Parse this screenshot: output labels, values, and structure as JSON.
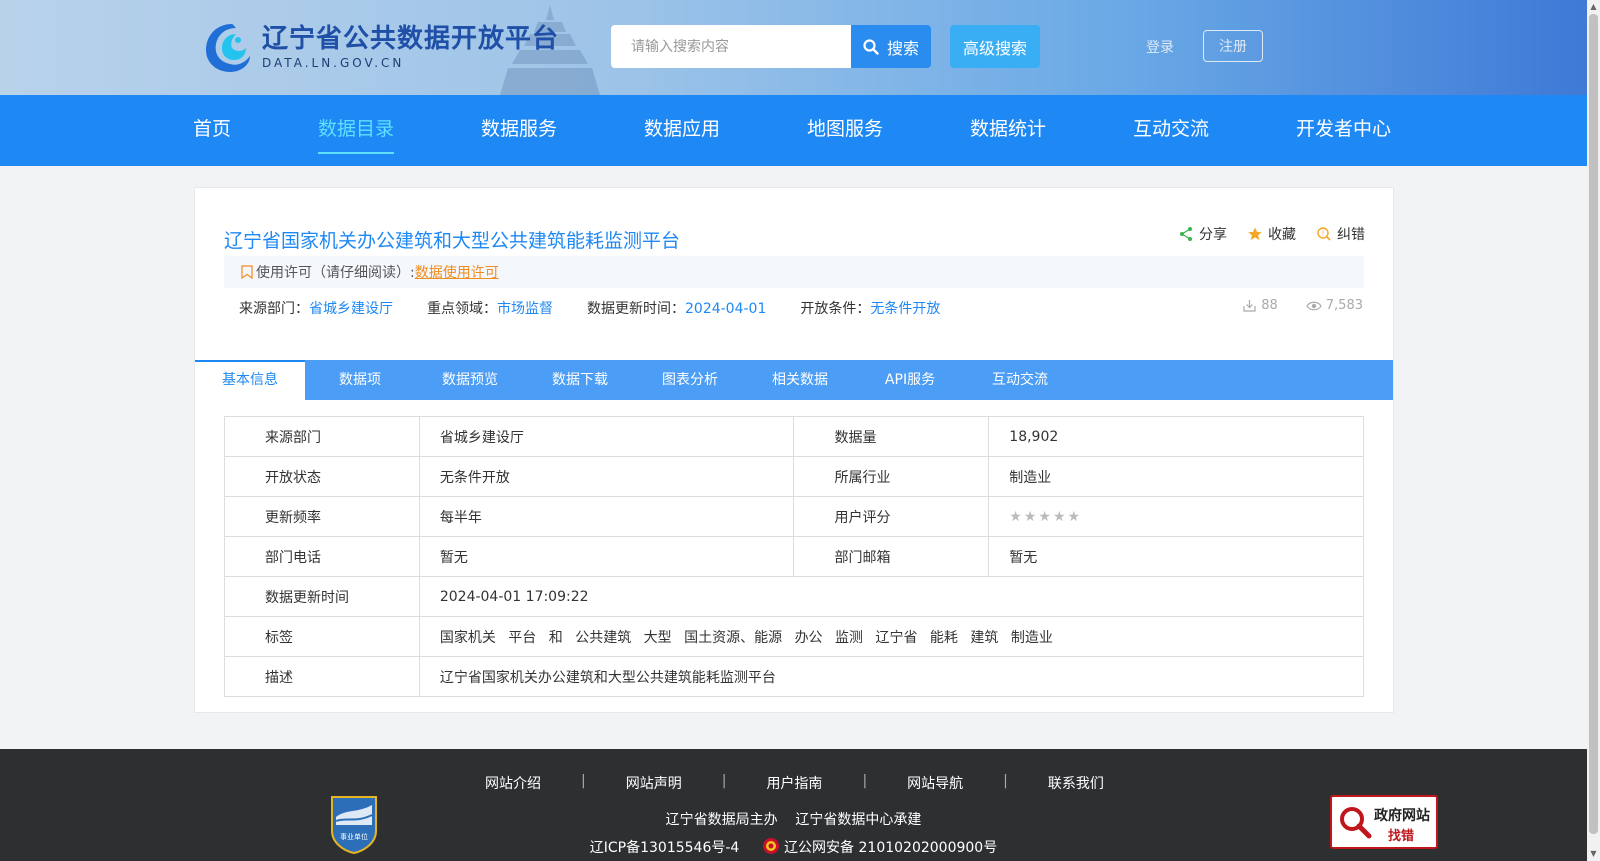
{
  "header": {
    "logo_title": "辽宁省公共数据开放平台",
    "logo_subtitle": "DATA.LN.GOV.CN",
    "search_placeholder": "请输入搜索内容",
    "search_label": "搜索",
    "advanced_search_label": "高级搜索",
    "login_label": "登录",
    "register_label": "注册"
  },
  "nav": {
    "items": [
      "首页",
      "数据目录",
      "数据服务",
      "数据应用",
      "地图服务",
      "数据统计",
      "互动交流",
      "开发者中心"
    ],
    "active": "数据目录"
  },
  "dataset": {
    "title": "辽宁省国家机关办公建筑和大型公共建筑能耗监测平台",
    "actions": {
      "share": "分享",
      "favorite": "收藏",
      "correct": "纠错"
    },
    "license_prefix": "使用许可（请仔细阅读）:",
    "license_link": "数据使用许可",
    "meta": {
      "source_label": "来源部门：",
      "source_value": "省城乡建设厅",
      "domain_label": "重点领域：",
      "domain_value": "市场监督",
      "updated_label": "数据更新时间：",
      "updated_value": "2024-04-01",
      "open_label": "开放条件：",
      "open_value": "无条件开放"
    },
    "downloads": "88",
    "views": "7,583"
  },
  "tabs": [
    "基本信息",
    "数据项",
    "数据预览",
    "数据下载",
    "图表分析",
    "相关数据",
    "API服务",
    "互动交流"
  ],
  "active_tab": "基本信息",
  "info": {
    "source_dept_label": "来源部门",
    "source_dept": "省城乡建设厅",
    "data_volume_label": "数据量",
    "data_volume": "18,902",
    "open_status_label": "开放状态",
    "open_status": "无条件开放",
    "industry_label": "所属行业",
    "industry": "制造业",
    "frequency_label": "更新频率",
    "frequency": "每半年",
    "rating_label": "用户评分",
    "rating_stars": "★★★★★",
    "rating_value": 0,
    "phone_label": "部门电话",
    "phone": "暂无",
    "email_label": "部门邮箱",
    "email": "暂无",
    "update_time_label": "数据更新时间",
    "update_time": "2024-04-01 17:09:22",
    "tags_label": "标签",
    "tags": [
      "国家机关",
      "平台",
      "和",
      "公共建筑",
      "大型",
      "国土资源、能源",
      "办公",
      "监测",
      "辽宁省",
      "能耗",
      "建筑",
      "制造业"
    ],
    "description_label": "描述",
    "description": "辽宁省国家机关办公建筑和大型公共建筑能耗监测平台"
  },
  "footer": {
    "links": [
      "网站介绍",
      "网站声明",
      "用户指南",
      "网站导航",
      "联系我们"
    ],
    "line1_a": "辽宁省数据局主办",
    "line1_b": "辽宁省数据中心承建",
    "icp": "辽ICP备13015546号-4",
    "police": "辽公网安备 21010202000900号",
    "badge_text": "事业单位",
    "gov_error_t1": "政府网站",
    "gov_error_t2": "找错"
  },
  "colors": {
    "primary": "#1e88f5",
    "nav_active": "#5fe0ff",
    "license": "#f08c1e",
    "footer_bg": "#2d2f31"
  }
}
